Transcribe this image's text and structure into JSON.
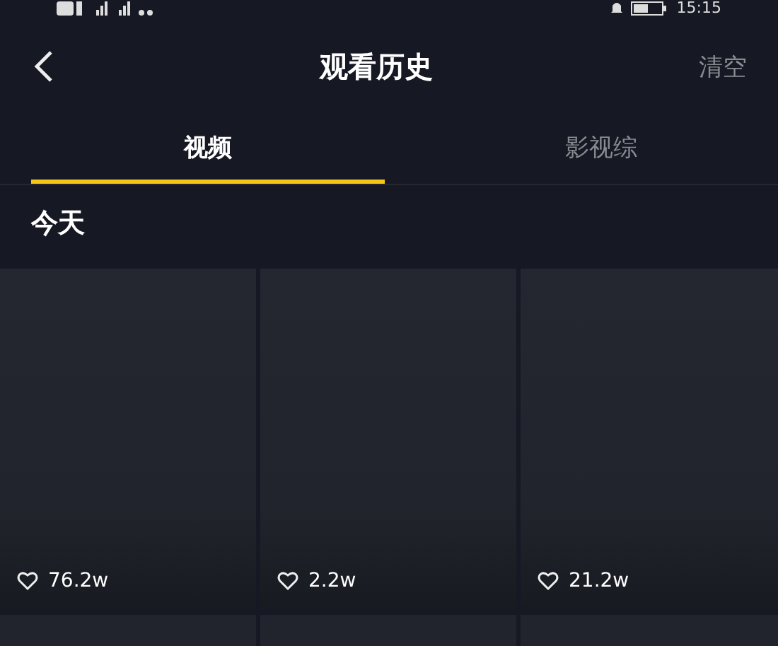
{
  "status_bar": {
    "time": "15:15"
  },
  "header": {
    "title": "观看历史",
    "action": "清空"
  },
  "tabs": [
    {
      "label": "视频",
      "selected": true
    },
    {
      "label": "影视综",
      "selected": false
    }
  ],
  "section": {
    "title": "今天"
  },
  "videos": [
    {
      "likes": "76.2w"
    },
    {
      "likes": "2.2w"
    },
    {
      "likes": "21.2w"
    }
  ]
}
